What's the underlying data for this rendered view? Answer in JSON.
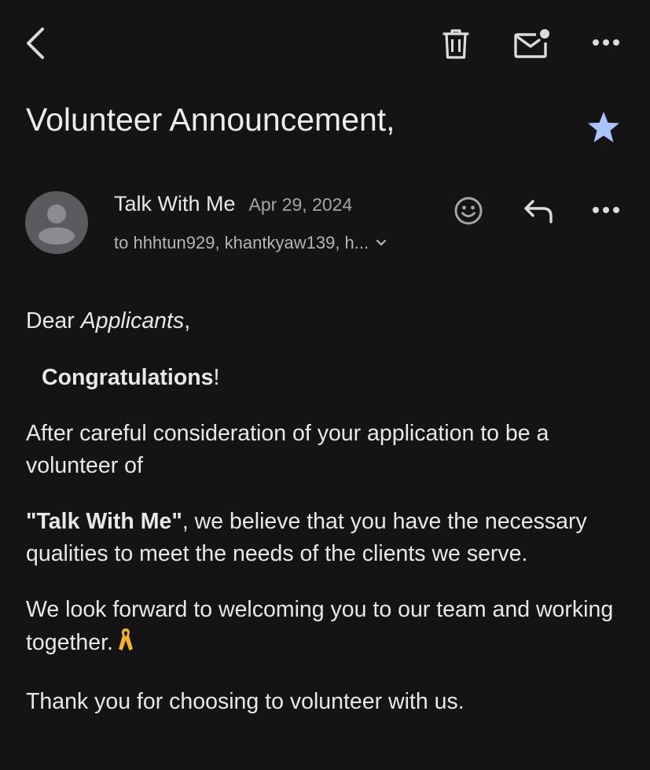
{
  "toolbar": {
    "back_icon": "chevron-left-icon",
    "trash_icon": "trash-icon",
    "unread_icon": "mark-unread-icon",
    "more_icon": "more-horizontal-icon"
  },
  "email": {
    "subject": "Volunteer Announcement,",
    "starred": true,
    "star_color": "#a9c4ff",
    "sender": {
      "name": "Talk With Me",
      "date": "Apr 29, 2024",
      "recipients": "to hhhtun929, khantkyaw139, h..."
    },
    "actions": {
      "emoji_icon": "emoji-react-icon",
      "reply_icon": "reply-icon",
      "more_icon": "more-horizontal-icon"
    },
    "body": {
      "greeting_prefix": "Dear ",
      "greeting_name": "Applicants",
      "greeting_suffix": ",",
      "congrats_word": "Congratulations",
      "congrats_suffix": "!",
      "para1": "After careful consideration of your application to be a volunteer of",
      "para2_org": "\"Talk With Me\"",
      "para2_rest": ", we believe that you have the necessary qualities to meet the needs of the clients we serve.",
      "para3": "We look forward to welcoming you to our team and working together.",
      "para3_emoji": "ribbon-icon",
      "para4": "Thank you for choosing to volunteer with us."
    }
  },
  "colors": {
    "background": "#141414",
    "text": "#e8e8e8",
    "secondary_text": "#a5a5a5",
    "avatar_bg": "#5b5b5f",
    "ribbon": "#f0b429"
  }
}
